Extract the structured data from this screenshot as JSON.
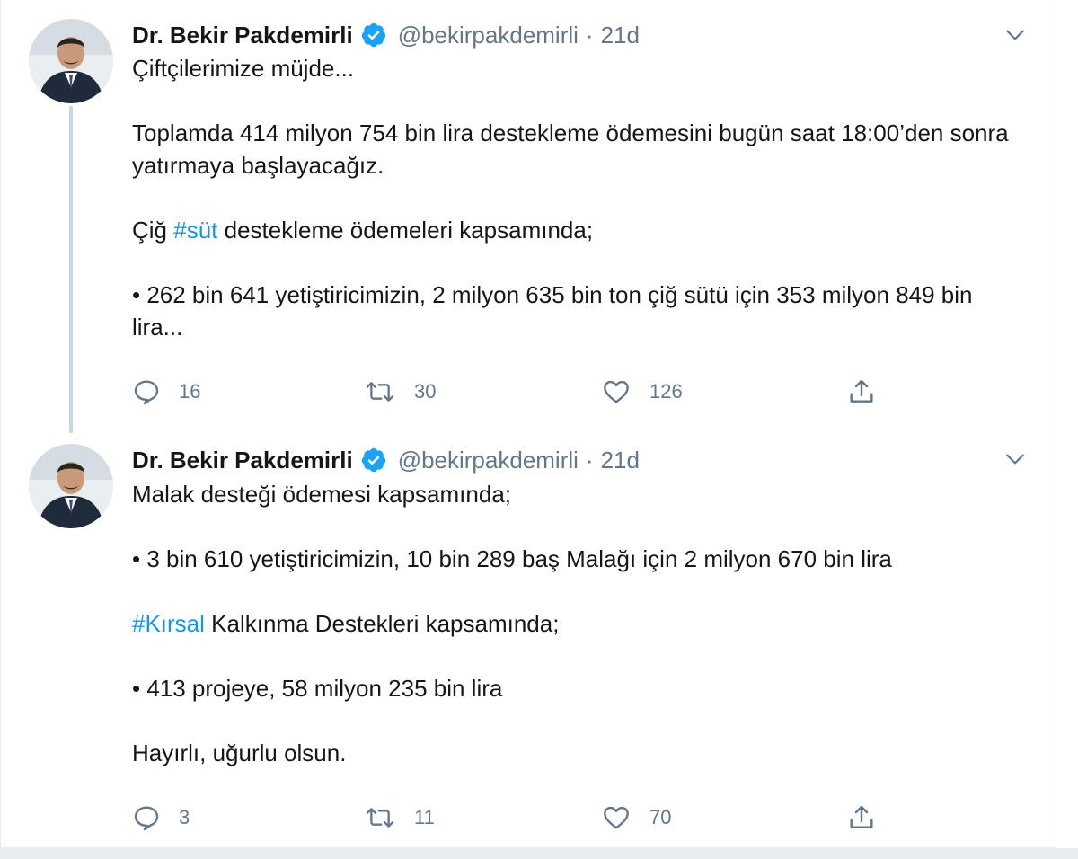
{
  "tweets": [
    {
      "author_name": "Dr. Bekir Pakdemirli",
      "handle": "@bekirpakdemirli",
      "separator": "·",
      "time": "21d",
      "paragraphs": [
        {
          "text": "Çiftçilerimize müjde..."
        },
        {
          "text": "Toplamda 414 milyon 754 bin lira destekleme ödemesini bugün saat 18:00’den sonra yatırmaya başlayacağız."
        },
        {
          "before": "Çiğ ",
          "hashtag": "#süt",
          "after": " destekleme ödemeleri kapsamında;"
        },
        {
          "text": "• 262 bin 641 yetiştiricimizin, 2 milyon 635 bin ton çiğ sütü için 353 milyon 849 bin lira..."
        }
      ],
      "stats": {
        "replies": "16",
        "retweets": "30",
        "likes": "126"
      }
    },
    {
      "author_name": "Dr. Bekir Pakdemirli",
      "handle": "@bekirpakdemirli",
      "separator": "·",
      "time": "21d",
      "paragraphs": [
        {
          "text": "Malak desteği ödemesi kapsamında;"
        },
        {
          "text": "• 3 bin 610 yetiştiricimizin, 10 bin 289 baş Malağı için 2 milyon 670 bin lira"
        },
        {
          "before": "",
          "hashtag": "#Kırsal",
          "after": " Kalkınma Destekleri kapsamında;"
        },
        {
          "text": "• 413 projeye, 58 milyon 235 bin lira"
        },
        {
          "text": "Hayırlı, uğurlu olsun."
        }
      ],
      "stats": {
        "replies": "3",
        "retweets": "11",
        "likes": "70"
      }
    }
  ],
  "icons": {
    "verified": "verified-badge-icon",
    "caret": "chevron-down-icon",
    "reply": "reply-icon",
    "retweet": "retweet-icon",
    "like": "like-icon",
    "share": "share-icon"
  },
  "colors": {
    "text": "#14171a",
    "secondary": "#657786",
    "link": "#1b95e0",
    "verified": "#1da1f2",
    "border": "#e6ecf0",
    "thread_line": "#ccd6dd"
  }
}
